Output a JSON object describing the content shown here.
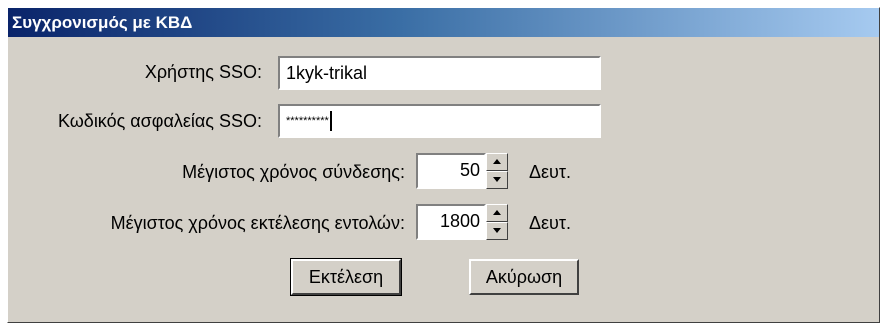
{
  "dialog": {
    "title": "Συγχρονισμός με ΚΒΔ",
    "sso_user": {
      "label": "Χρήστης SSO:",
      "value": "1kyk-trikal"
    },
    "sso_password": {
      "label": "Κωδικός ασφαλείας SSO:",
      "value": "**********"
    },
    "connect_timeout": {
      "label": "Μέγιστος χρόνος σύνδεσης:",
      "value": "50",
      "unit": "Δευτ."
    },
    "exec_timeout": {
      "label": "Μέγιστος χρόνος εκτέλεσης εντολών:",
      "value": "1800",
      "unit": "Δευτ."
    },
    "buttons": {
      "execute": "Εκτέλεση",
      "cancel": "Ακύρωση"
    },
    "colors": {
      "face": "#d4d0c8",
      "title_start": "#0a246a",
      "title_end": "#a6caf0"
    }
  }
}
